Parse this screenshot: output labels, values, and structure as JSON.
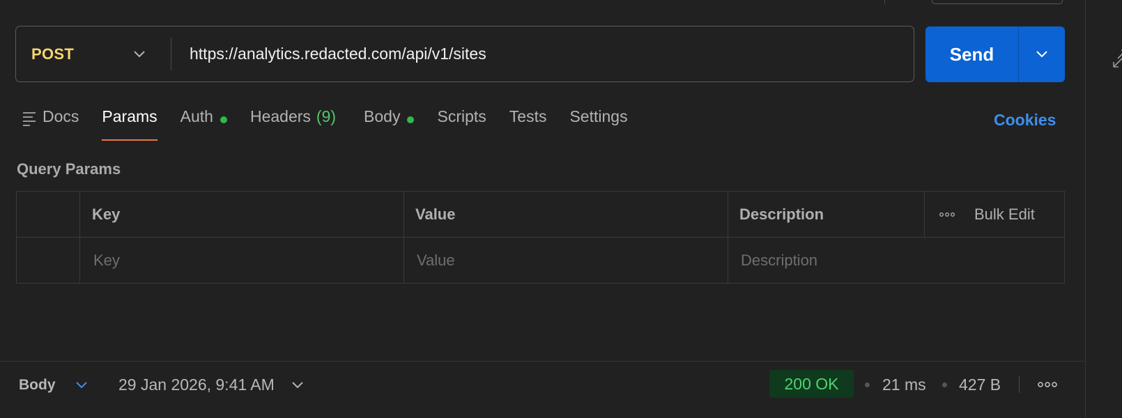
{
  "request": {
    "method": "POST",
    "url": "https://analytics.redacted.com/api/v1/sites",
    "send_label": "Send"
  },
  "tabs": [
    {
      "label": "Docs"
    },
    {
      "label": "Params",
      "active": true
    },
    {
      "label": "Auth",
      "status_dot": true
    },
    {
      "label": "Headers",
      "count": "(9)"
    },
    {
      "label": "Body",
      "status_dot": true
    },
    {
      "label": "Scripts"
    },
    {
      "label": "Tests"
    },
    {
      "label": "Settings"
    }
  ],
  "cookies_label": "Cookies",
  "query_params": {
    "title": "Query Params",
    "columns": {
      "key": "Key",
      "value": "Value",
      "description": "Description"
    },
    "bulk_edit_label": "Bulk Edit",
    "placeholders": {
      "key": "Key",
      "value": "Value",
      "description": "Description"
    }
  },
  "response": {
    "view_label": "Body",
    "timestamp": "29 Jan 2026, 9:41 AM",
    "status": "200 OK",
    "time": "21 ms",
    "size": "427 B"
  },
  "colors": {
    "method_post": "#f5d76e",
    "send": "#0b63d4",
    "status_ok": "#4cd56d",
    "active_tab_underline": "#e4774a",
    "link": "#3d8fef"
  }
}
